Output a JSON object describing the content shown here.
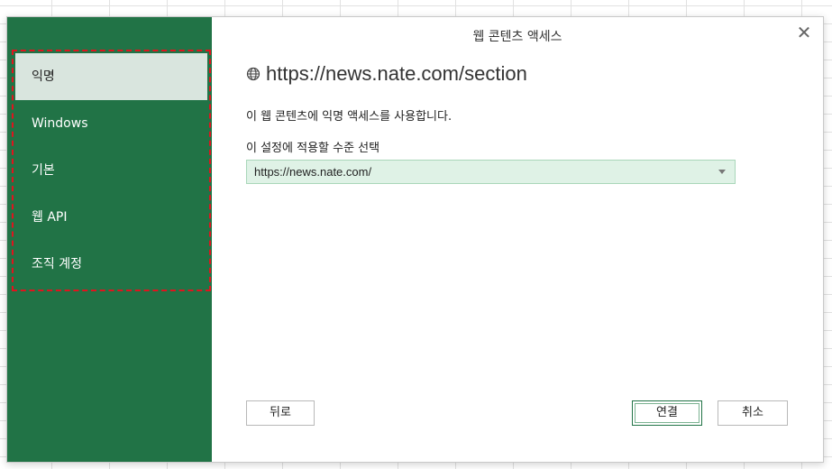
{
  "dialog": {
    "title": "웹 콘텐츠 액세스",
    "close_icon": "close-icon"
  },
  "sidebar": {
    "items": [
      {
        "label": "익명",
        "selected": true
      },
      {
        "label": "Windows",
        "selected": false
      },
      {
        "label": "기본",
        "selected": false
      },
      {
        "label": "웹 API",
        "selected": false
      },
      {
        "label": "조직 계정",
        "selected": false
      }
    ]
  },
  "main": {
    "url": "https://news.nate.com/section",
    "url_icon": "globe-icon",
    "description": "이 웹 콘텐츠에 익명 액세스를 사용합니다.",
    "level_label": "이 설정에 적용할 수준 선택",
    "level_select": {
      "value": "https://news.nate.com/"
    }
  },
  "buttons": {
    "back": "뒤로",
    "connect": "연결",
    "cancel": "취소"
  },
  "colors": {
    "sidebar": "#217346",
    "selected_item": "#d9e5de",
    "select_bg": "#dff2e6",
    "highlight_dash": "#e0141e"
  }
}
